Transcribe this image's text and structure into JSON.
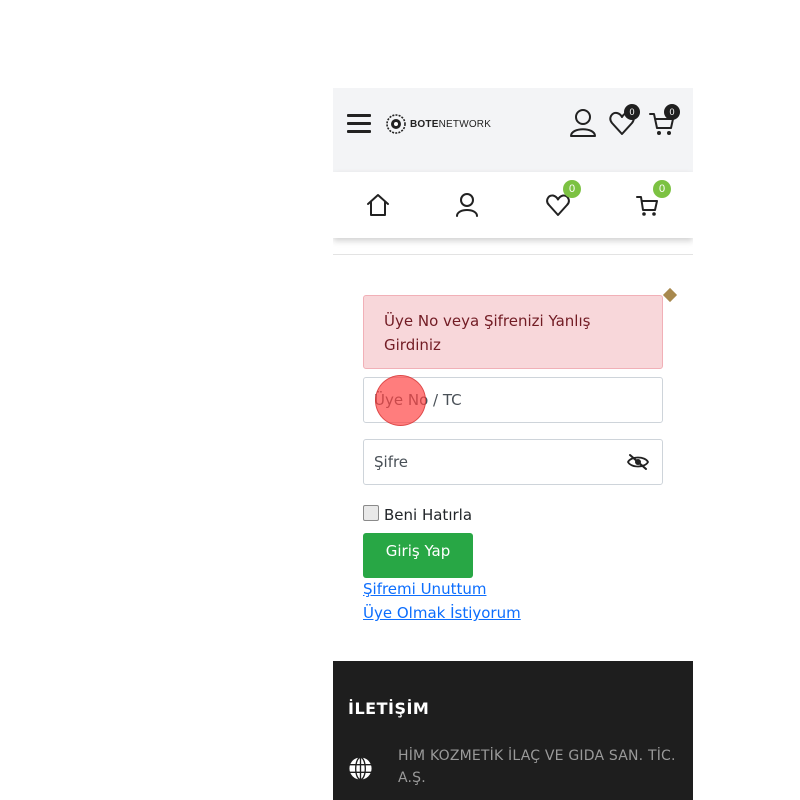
{
  "header": {
    "logo_text_bold": "BOTE",
    "logo_text_regular": "NETWORK",
    "wishlist_count": "0",
    "cart_count": "0"
  },
  "navbar": {
    "wishlist_count": "0",
    "cart_count": "0"
  },
  "login": {
    "error_message": "Üye No veya Şifrenizi Yanlış Girdiniz",
    "member_no_placeholder": "Üye No / TC",
    "password_placeholder": "Şifre",
    "remember_label": "Beni Hatırla",
    "submit_label": "Giriş Yap",
    "forgot_link": "Şifremi Unuttum",
    "register_link": "Üye Olmak İstiyorum"
  },
  "footer": {
    "title": "İLETİŞİM",
    "company": "HİM KOZMETİK İLAÇ VE GIDA SAN. TİC. A.Ş."
  },
  "colors": {
    "header_bg": "#f3f4f6",
    "nav_badge": "#7cc242",
    "header_badge": "#1f1f1f",
    "alert_bg": "#f8d7da",
    "alert_text": "#721c24",
    "primary_button": "#28a745",
    "link": "#0d6efd",
    "footer_bg": "#1e1e1e"
  },
  "icons": [
    "hamburger-icon",
    "user-icon",
    "heart-icon",
    "cart-icon",
    "home-icon",
    "eye-slash-icon",
    "globe-icon"
  ]
}
